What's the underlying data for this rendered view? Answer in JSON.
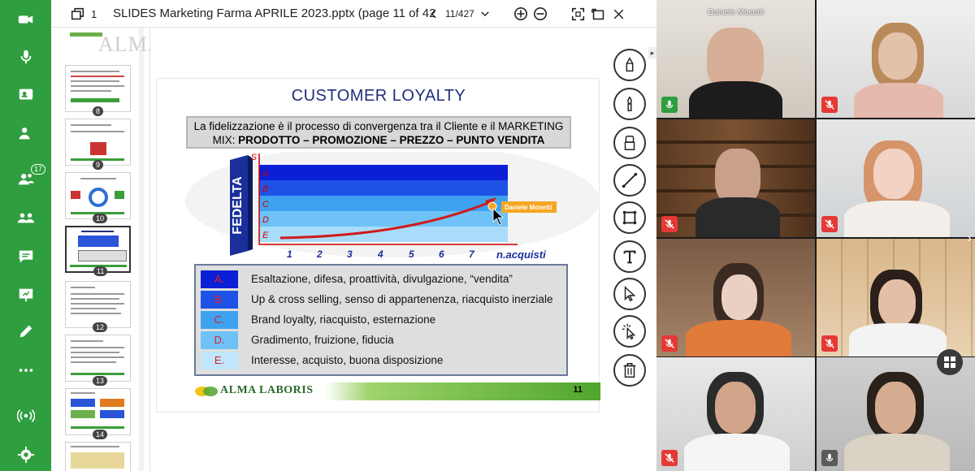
{
  "sidebar": {
    "items": [
      {
        "icon": "camera-icon"
      },
      {
        "icon": "microphone-icon"
      },
      {
        "icon": "share-screen-icon"
      },
      {
        "icon": "presenter-icon"
      },
      {
        "icon": "participants-icon",
        "badge": "17"
      },
      {
        "icon": "breakout-icon"
      },
      {
        "icon": "chat-icon"
      },
      {
        "icon": "present-icon"
      },
      {
        "icon": "whiteboard-pen-icon"
      },
      {
        "icon": "more-icon"
      },
      {
        "icon": "broadcast-icon"
      },
      {
        "icon": "settings-icon"
      }
    ]
  },
  "viewer": {
    "page_count_badge": "1",
    "file_title": "SLIDES Marketing Farma APRILE 2023.pptx (page 11 of 427)",
    "page_indicator": "11/427"
  },
  "thumbnails": [
    {
      "num": ""
    },
    {
      "num": "8"
    },
    {
      "num": "9"
    },
    {
      "num": "10"
    },
    {
      "num": "11"
    },
    {
      "num": "12"
    },
    {
      "num": "13"
    },
    {
      "num": "14"
    },
    {
      "num": ""
    }
  ],
  "watermark": "ALMA LABORIS",
  "slide": {
    "title": "CUSTOMER LOYALTY",
    "box_line1": "La fidelizzazione è il processo di convergenza tra il Cliente e il MARKETING",
    "box_line2_prefix": "MIX: ",
    "box_line2_bold": "PRODOTTO – PROMOZIONE – PREZZO – PUNTO VENDITA",
    "chart_y_axis": "S",
    "chart_x_axis": "n.acquisti",
    "chart_side_label": "FEDELTA",
    "chart_rows": [
      "A",
      "B",
      "C",
      "D",
      "E"
    ],
    "chart_x_ticks": [
      "1",
      "2",
      "3",
      "4",
      "5",
      "6",
      "7"
    ],
    "pointer_label": "Daniele Mosetti",
    "legend": [
      {
        "letter": "A.",
        "text": "Esaltazione, difesa, proattività, divulgazione, “vendita”"
      },
      {
        "letter": "B.",
        "text": "Up & cross selling, senso di appartenenza, riacquisto inerziale"
      },
      {
        "letter": "C.",
        "text": "Brand loyalty, riacquisto, esternazione"
      },
      {
        "letter": "D.",
        "text": "Gradimento, fruizione, fiducia"
      },
      {
        "letter": "E.",
        "text": "Interesse, acquisto, buona disposizione"
      }
    ],
    "footer_logo": "ALMA LABORIS",
    "footer_page": "11"
  },
  "participants": [
    {
      "name": "Daniele Mosetti",
      "mic": "on"
    },
    {
      "name": "",
      "mic": "muted"
    },
    {
      "name": "",
      "mic": "muted"
    },
    {
      "name": "",
      "mic": "muted"
    },
    {
      "name": "",
      "mic": "muted"
    },
    {
      "name": "",
      "mic": "muted"
    },
    {
      "name": "",
      "mic": "muted"
    },
    {
      "name": "",
      "mic": "grey"
    }
  ],
  "colors": {
    "sidebar_green": "#2e9e3f",
    "mic_on": "#2e9e3f",
    "mic_muted": "#e53935",
    "slide_title": "#1f2f7a"
  }
}
